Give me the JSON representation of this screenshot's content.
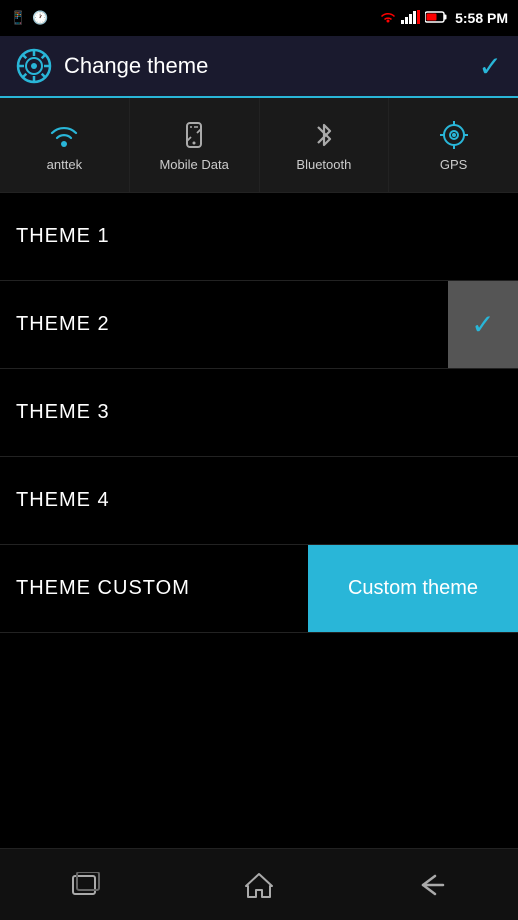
{
  "statusBar": {
    "time": "5:58 PM",
    "icons": [
      "phone",
      "clock",
      "wifi",
      "signal",
      "battery"
    ]
  },
  "header": {
    "title": "Change theme",
    "checkmark": "✓",
    "iconLabel": "gear-icon"
  },
  "toggles": [
    {
      "id": "anttek",
      "label": "anttek",
      "icon": "wifi"
    },
    {
      "id": "mobile-data",
      "label": "Mobile Data",
      "icon": "mobile"
    },
    {
      "id": "bluetooth",
      "label": "Bluetooth",
      "icon": "bluetooth"
    },
    {
      "id": "gps",
      "label": "GPS",
      "icon": "gps"
    }
  ],
  "themes": [
    {
      "id": "theme1",
      "label": "THEME 1",
      "selected": false
    },
    {
      "id": "theme2",
      "label": "THEME 2",
      "selected": true
    },
    {
      "id": "theme3",
      "label": "THEME 3",
      "selected": false
    },
    {
      "id": "theme4",
      "label": "THEME 4",
      "selected": false
    }
  ],
  "themeCustom": {
    "rowLabel": "THEME CUSTOM",
    "buttonLabel": "Custom theme"
  },
  "bottomNav": {
    "recentsLabel": "⬜",
    "homeLabel": "⌂",
    "backLabel": "←"
  }
}
